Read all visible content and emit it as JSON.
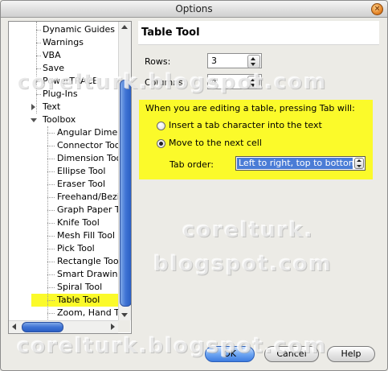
{
  "window": {
    "title": "Options"
  },
  "tree": {
    "items": [
      {
        "label": "Dynamic Guides",
        "indent": 1
      },
      {
        "label": "Warnings",
        "indent": 1
      },
      {
        "label": "VBA",
        "indent": 1
      },
      {
        "label": "Save",
        "indent": 1
      },
      {
        "label": "PowerTRACE",
        "indent": 1
      },
      {
        "label": "Plug-Ins",
        "indent": 1
      },
      {
        "label": "Text",
        "indent": 0,
        "expander": "collapsed"
      },
      {
        "label": "Toolbox",
        "indent": 0,
        "expander": "expanded"
      },
      {
        "label": "Angular Dimens",
        "indent": 2
      },
      {
        "label": "Connector Tool",
        "indent": 2
      },
      {
        "label": "Dimension Tool",
        "indent": 2
      },
      {
        "label": "Ellipse Tool",
        "indent": 2
      },
      {
        "label": "Eraser Tool",
        "indent": 2
      },
      {
        "label": "Freehand/Bezie",
        "indent": 2
      },
      {
        "label": "Graph Paper To",
        "indent": 2
      },
      {
        "label": "Knife Tool",
        "indent": 2
      },
      {
        "label": "Mesh Fill Tool",
        "indent": 2
      },
      {
        "label": "Pick Tool",
        "indent": 2
      },
      {
        "label": "Rectangle Tool",
        "indent": 2
      },
      {
        "label": "Smart Drawing",
        "indent": 2
      },
      {
        "label": "Spiral Tool",
        "indent": 2
      },
      {
        "label": "Table Tool",
        "indent": 2,
        "selected": true
      },
      {
        "label": "Zoom, Hand To",
        "indent": 2
      }
    ]
  },
  "panel": {
    "title": "Table Tool",
    "rows_label": "Rows:",
    "rows_value": "3",
    "columns_label": "Columns:",
    "columns_value": "4",
    "tab_group_label": "When you are editing a table, pressing Tab will:",
    "option_insert": "Insert a tab character into the text",
    "option_move": "Move to the next cell",
    "selected_option": "move",
    "tab_order_label": "Tab order:",
    "tab_order_value": "Left to right, top to bottom"
  },
  "buttons": {
    "ok": "OK",
    "cancel": "Cancel",
    "help": "Help"
  },
  "watermarks": [
    "corelturk.blogspot.com",
    "corelturk.",
    "blogspot.com",
    "corelturk.blogspot.com"
  ],
  "colors": {
    "highlight": "#fbfa2a",
    "accent": "#3f73d4"
  }
}
